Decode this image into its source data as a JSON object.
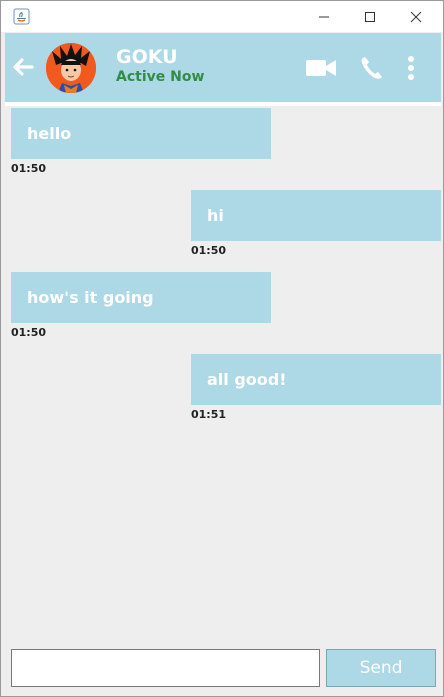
{
  "window": {
    "controls": [
      "minimize-icon",
      "maximize-icon",
      "close-icon"
    ]
  },
  "header": {
    "contact_name": "GOKU",
    "status": "Active Now",
    "icons": [
      "back-arrow-icon",
      "video-call-icon",
      "phone-icon",
      "more-vert-icon"
    ]
  },
  "colors": {
    "accent": "#add8e6",
    "status_green": "#2f8d46",
    "background": "#eeeeee"
  },
  "messages": [
    {
      "side": "left",
      "text": "hello",
      "time": "01:50"
    },
    {
      "side": "right",
      "text": "hi",
      "time": "01:50"
    },
    {
      "side": "left",
      "text": "how's it going",
      "time": "01:50"
    },
    {
      "side": "right",
      "text": "all good!",
      "time": "01:51"
    }
  ],
  "composer": {
    "input_value": "",
    "send_label": "Send"
  }
}
